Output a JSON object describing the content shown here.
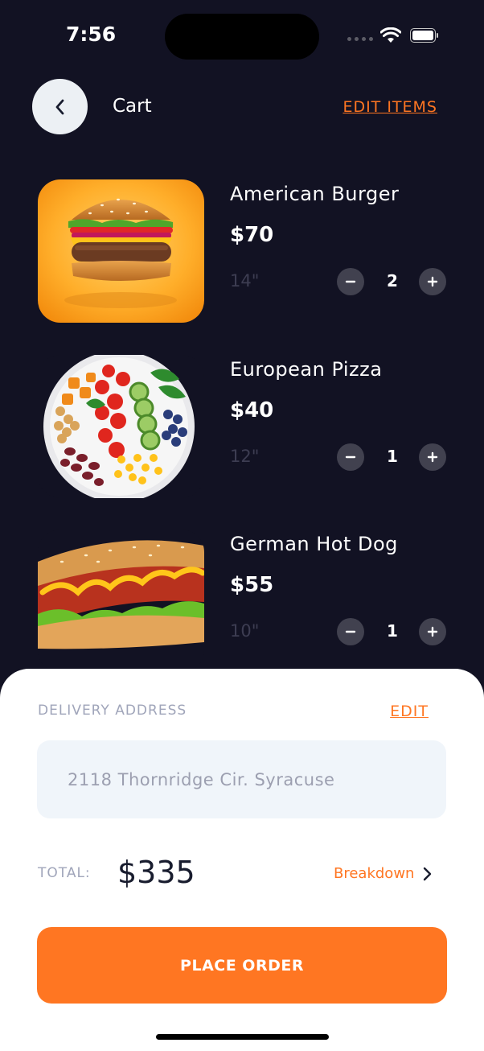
{
  "status_bar": {
    "time": "7:56"
  },
  "header": {
    "title": "Cart",
    "edit_items": "EDIT ITEMS"
  },
  "items": [
    {
      "name": "American Burger",
      "price": "$70",
      "size": "14\"",
      "quantity": "2",
      "image_icon": "burger-image"
    },
    {
      "name": "European Pizza",
      "price": "$40",
      "size": "12\"",
      "quantity": "1",
      "image_icon": "salad-bowl-image"
    },
    {
      "name": "German Hot Dog",
      "price": "$55",
      "size": "10\"",
      "quantity": "1",
      "image_icon": "hot-dog-image"
    }
  ],
  "delivery": {
    "label": "DELIVERY ADDRESS",
    "edit": "EDIT",
    "address": "2118 Thornridge Cir. Syracuse"
  },
  "total": {
    "label": "TOTAL:",
    "value": "$335",
    "breakdown": "Breakdown"
  },
  "actions": {
    "place_order": "PLACE ORDER"
  },
  "colors": {
    "accent": "#ff7622",
    "background": "#121223",
    "sheet": "#ffffff",
    "field": "#f0f5fa",
    "qty_button": "#41414f"
  }
}
